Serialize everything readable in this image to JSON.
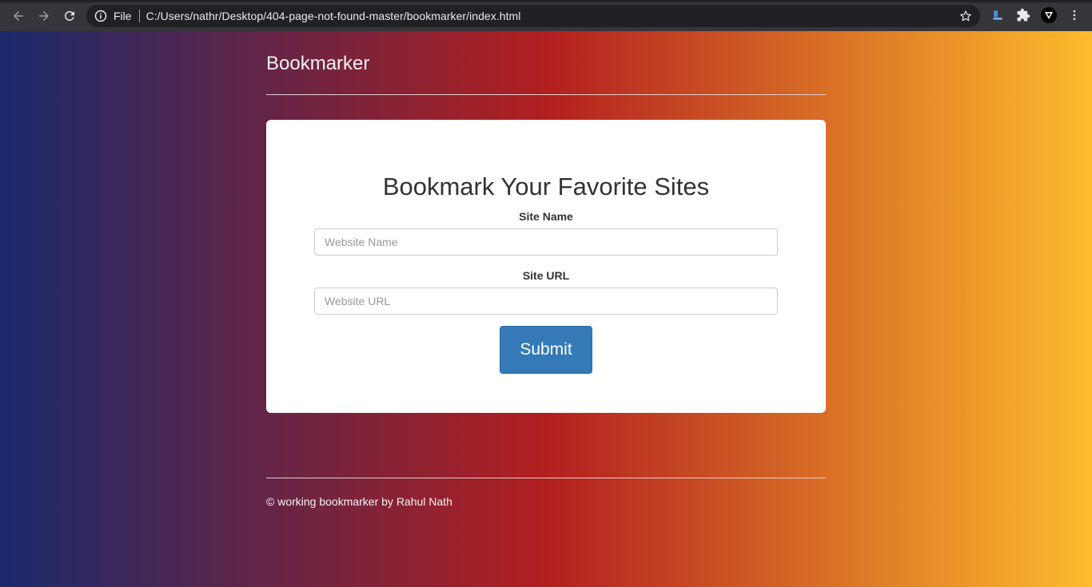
{
  "browser": {
    "scheme": "File",
    "url": "C:/Users/nathr/Desktop/404-page-not-found-master/bookmarker/index.html",
    "icons": {
      "back": "back-arrow-icon",
      "forward": "forward-arrow-icon",
      "reload": "reload-icon",
      "info": "info-icon",
      "bookmark": "star-icon",
      "extensions": [
        "download-extension-icon",
        "puzzle-extension-icon",
        "vpn-extension-icon",
        "menu-kebab-icon"
      ]
    }
  },
  "header": {
    "brand": "Bookmarker"
  },
  "form": {
    "title": "Bookmark Your Favorite Sites",
    "site_name_label": "Site Name",
    "site_name_placeholder": "Website Name",
    "site_url_label": "Site URL",
    "site_url_placeholder": "Website URL",
    "submit_label": "Submit"
  },
  "footer": {
    "text": "© working bookmarker by Rahul Nath"
  },
  "colors": {
    "gradient_left": "#1a2a6c",
    "gradient_mid": "#b21f1f",
    "gradient_right": "#fdbb2d",
    "primary_button": "#337ab7"
  }
}
